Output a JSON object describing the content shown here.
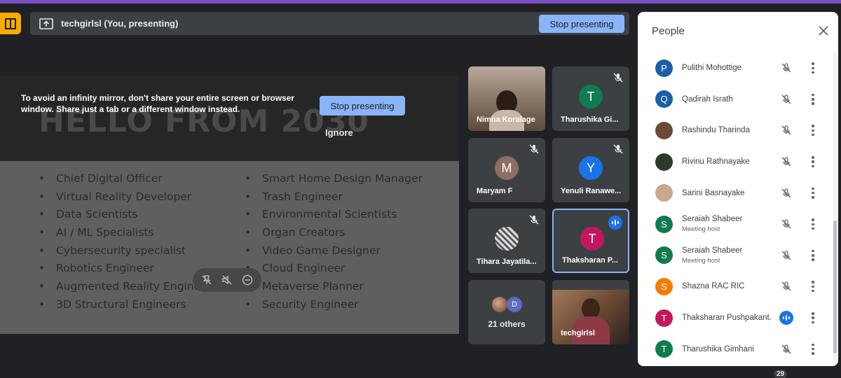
{
  "colors": {
    "accent": "#8ab4f8",
    "tile_bg": "#3c4043",
    "bg": "#202124",
    "speaking": "#1a73e8",
    "logo": "#f9ab00"
  },
  "presenting_bar": {
    "title": "techgirlsl (You, presenting)",
    "stop_label": "Stop presenting",
    "icon": "present-screen-icon"
  },
  "shared_screen": {
    "warning_text": "To avoid an infinity mirror, don't share your entire screen or browser window. Share just a tab or a different window instead.",
    "stop_label": "Stop presenting",
    "ignore_label": "Ignore",
    "slide_title": "HELLO FROM 2030",
    "left_list": [
      "Chief Digital Officer",
      "Virtual Reality Developer",
      "Data Scientists",
      "AI / ML Specialists",
      "Cybersecurity specialist",
      "Robotics Engineer",
      "Augmented Reality Engineers",
      "3D Structural Engineers"
    ],
    "right_list": [
      "Smart Home Design Manager",
      "Trash Engineer",
      "Environmental Scientists",
      "Organ Creators",
      "Video Game Designer",
      "Cloud Engineer",
      "Metaverse Planner",
      "Security Engineer"
    ]
  },
  "tiles": [
    {
      "name": "Nimna Koralage"
    },
    {
      "name": "Tharushika Gi...",
      "initial": "T"
    },
    {
      "name": "Maryam F",
      "initial": "M"
    },
    {
      "name": "Yenuli Ranawe...",
      "initial": "Y"
    },
    {
      "name": "Tihara Jayatila..."
    },
    {
      "name": "Thaksharan P...",
      "initial": "T"
    },
    {
      "others_label": "21 others",
      "initial": "D"
    },
    {
      "name": "techgirlsl"
    }
  ],
  "people_panel": {
    "title": "People",
    "participants": [
      {
        "name": "Pulithi Mohottige",
        "initial": "P",
        "color": "#1a5fa8",
        "status": "muted"
      },
      {
        "name": "Qadirah Israth",
        "initial": "Q",
        "color": "#1a5fa8",
        "status": "muted"
      },
      {
        "name": "Rashindu Tharinda",
        "initial": "",
        "color": "#6b4a3a",
        "status": "muted"
      },
      {
        "name": "Rivinu Rathnayake",
        "initial": "",
        "color": "#2d3a2a",
        "status": "muted"
      },
      {
        "name": "Sarini Basnayake",
        "initial": "",
        "color": "#c9a98c",
        "status": "muted"
      },
      {
        "name": "Seraiah Shabeer",
        "role": "Meeting host",
        "initial": "S",
        "color": "#0f7b4f",
        "status": "muted"
      },
      {
        "name": "Seraiah Shabeer",
        "role": "Meeting host",
        "initial": "S",
        "color": "#0f7b4f",
        "status": "muted"
      },
      {
        "name": "Shazna RAC RIC",
        "initial": "S",
        "color": "#f57c00",
        "status": "muted"
      },
      {
        "name": "Thaksharan Pushpakant...",
        "initial": "T",
        "color": "#c2185b",
        "status": "speaking"
      },
      {
        "name": "Tharushika Gimhani",
        "initial": "T",
        "color": "#0f7b4f",
        "status": "muted"
      }
    ]
  },
  "participant_count": "29"
}
